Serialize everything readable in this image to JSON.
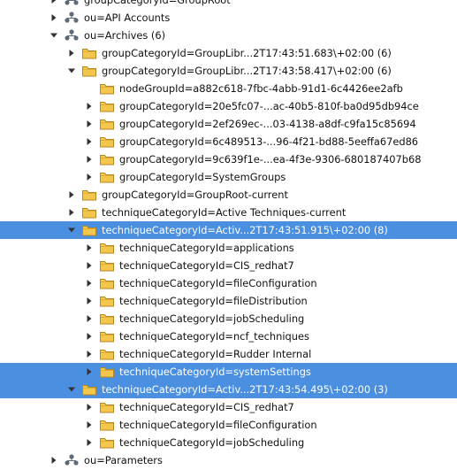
{
  "tree": {
    "rows": [
      {
        "label": "groupCategoryId=GroupRoot",
        "depth": 0,
        "icon": "org-unit-icon",
        "toggle": "collapsed",
        "selected": false
      },
      {
        "label": "ou=API Accounts",
        "depth": 0,
        "icon": "org-unit-icon",
        "toggle": "collapsed",
        "selected": false
      },
      {
        "label": "ou=Archives (6)",
        "depth": 0,
        "icon": "org-unit-icon",
        "toggle": "expanded",
        "selected": false
      },
      {
        "label": "groupCategoryId=GroupLibr...2T17:43:51.683\\+02:00 (6)",
        "depth": 1,
        "icon": "folder-icon",
        "toggle": "collapsed",
        "selected": false
      },
      {
        "label": "groupCategoryId=GroupLibr...2T17:43:58.417\\+02:00 (6)",
        "depth": 1,
        "icon": "folder-icon",
        "toggle": "expanded",
        "selected": false
      },
      {
        "label": "nodeGroupId=a882c618-7fbc-4abb-91d1-6c4426ee2afb",
        "depth": 2,
        "icon": "folder-icon",
        "toggle": "none",
        "selected": false
      },
      {
        "label": "groupCategoryId=20e5fc07-...ac-40b5-810f-ba0d95db94ce",
        "depth": 2,
        "icon": "folder-icon",
        "toggle": "collapsed",
        "selected": false
      },
      {
        "label": "groupCategoryId=2ef269ec-...03-4138-a8df-c9fa15c85694",
        "depth": 2,
        "icon": "folder-icon",
        "toggle": "collapsed",
        "selected": false
      },
      {
        "label": "groupCategoryId=6c489513-...96-4f21-bd88-5eeffa67ed86",
        "depth": 2,
        "icon": "folder-icon",
        "toggle": "collapsed",
        "selected": false
      },
      {
        "label": "groupCategoryId=9c639f1e-...ea-4f3e-9306-680187407b68",
        "depth": 2,
        "icon": "folder-icon",
        "toggle": "collapsed",
        "selected": false
      },
      {
        "label": "groupCategoryId=SystemGroups",
        "depth": 2,
        "icon": "folder-icon",
        "toggle": "collapsed",
        "selected": false
      },
      {
        "label": "groupCategoryId=GroupRoot-current",
        "depth": 1,
        "icon": "folder-icon",
        "toggle": "collapsed",
        "selected": false
      },
      {
        "label": "techniqueCategoryId=Active Techniques-current",
        "depth": 1,
        "icon": "folder-icon",
        "toggle": "collapsed",
        "selected": false
      },
      {
        "label": "techniqueCategoryId=Activ...2T17:43:51.915\\+02:00 (8)",
        "depth": 1,
        "icon": "folder-icon",
        "toggle": "expanded",
        "selected": true
      },
      {
        "label": "techniqueCategoryId=applications",
        "depth": 2,
        "icon": "folder-icon",
        "toggle": "collapsed",
        "selected": false
      },
      {
        "label": "techniqueCategoryId=CIS_redhat7",
        "depth": 2,
        "icon": "folder-icon",
        "toggle": "collapsed",
        "selected": false
      },
      {
        "label": "techniqueCategoryId=fileConfiguration",
        "depth": 2,
        "icon": "folder-icon",
        "toggle": "collapsed",
        "selected": false
      },
      {
        "label": "techniqueCategoryId=fileDistribution",
        "depth": 2,
        "icon": "folder-icon",
        "toggle": "collapsed",
        "selected": false
      },
      {
        "label": "techniqueCategoryId=jobScheduling",
        "depth": 2,
        "icon": "folder-icon",
        "toggle": "collapsed",
        "selected": false
      },
      {
        "label": "techniqueCategoryId=ncf_techniques",
        "depth": 2,
        "icon": "folder-icon",
        "toggle": "collapsed",
        "selected": false
      },
      {
        "label": "techniqueCategoryId=Rudder Internal",
        "depth": 2,
        "icon": "folder-icon",
        "toggle": "collapsed",
        "selected": false
      },
      {
        "label": "techniqueCategoryId=systemSettings",
        "depth": 2,
        "icon": "folder-icon",
        "toggle": "collapsed",
        "selected": true
      },
      {
        "label": "techniqueCategoryId=Activ...2T17:43:54.495\\+02:00 (3)",
        "depth": 1,
        "icon": "folder-icon",
        "toggle": "expanded",
        "selected": true
      },
      {
        "label": "techniqueCategoryId=CIS_redhat7",
        "depth": 2,
        "icon": "folder-icon",
        "toggle": "collapsed",
        "selected": false
      },
      {
        "label": "techniqueCategoryId=fileConfiguration",
        "depth": 2,
        "icon": "folder-icon",
        "toggle": "collapsed",
        "selected": false
      },
      {
        "label": "techniqueCategoryId=jobScheduling",
        "depth": 2,
        "icon": "folder-icon",
        "toggle": "collapsed",
        "selected": false
      },
      {
        "label": "ou=Parameters",
        "depth": 0,
        "icon": "org-unit-icon",
        "toggle": "collapsed",
        "selected": false
      }
    ]
  },
  "colors": {
    "selection": "#4a8fe0",
    "folder_fill": "#f3c64e",
    "folder_stroke": "#b9871c",
    "org_unit": "#5f6b7a"
  }
}
